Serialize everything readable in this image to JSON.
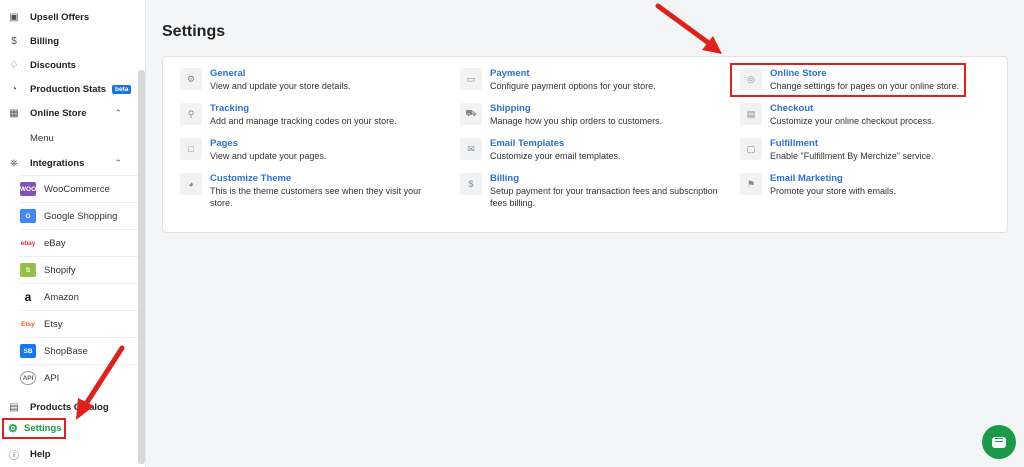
{
  "sidebar": {
    "items": [
      {
        "label": "Upsell Offers",
        "icon": "page-icon"
      },
      {
        "label": "Billing",
        "icon": "dollar-icon"
      },
      {
        "label": "Discounts",
        "icon": "tag-icon"
      },
      {
        "label": "Production Stats",
        "icon": "pie-chart-icon",
        "badge": "beta"
      },
      {
        "label": "Online Store",
        "icon": "store-icon"
      },
      {
        "label": "Integrations",
        "icon": "plug-icon"
      }
    ],
    "online_store_sub": "Menu",
    "integrations": [
      {
        "label": "WooCommerce",
        "logo": "WOO",
        "color": "#7f54b3"
      },
      {
        "label": "Google Shopping",
        "logo": "G",
        "color": "#4285f4"
      },
      {
        "label": "eBay",
        "logo": "ebay",
        "color": "#e53238"
      },
      {
        "label": "Shopify",
        "logo": "S",
        "color": "#95bf47"
      },
      {
        "label": "Amazon",
        "logo": "a",
        "color": "#111111"
      },
      {
        "label": "Etsy",
        "logo": "Etsy",
        "color": "#f16521"
      },
      {
        "label": "ShopBase",
        "logo": "SB",
        "color": "#1877f2"
      },
      {
        "label": "API",
        "logo": "API",
        "color": "#666666"
      }
    ],
    "products_catalog": "Products Catalog",
    "settings": "Settings",
    "help": "Help"
  },
  "main": {
    "title": "Settings",
    "settings": [
      {
        "title": "General",
        "desc": "View and update your store details.",
        "icon": "gear-icon"
      },
      {
        "title": "Payment",
        "desc": "Configure payment options for your store.",
        "icon": "credit-card-icon"
      },
      {
        "title": "Online Store",
        "desc": "Change settings for pages on your online store.",
        "icon": "globe-icon"
      },
      {
        "title": "Tracking",
        "desc": "Add and manage tracking codes on your store.",
        "icon": "search-icon"
      },
      {
        "title": "Shipping",
        "desc": "Manage how you ship orders to customers.",
        "icon": "truck-icon"
      },
      {
        "title": "Checkout",
        "desc": "Customize your online checkout process.",
        "icon": "cart-icon"
      },
      {
        "title": "Pages",
        "desc": "View and update your pages.",
        "icon": "file-icon"
      },
      {
        "title": "Email Templates",
        "desc": "Customize your email templates.",
        "icon": "mail-icon"
      },
      {
        "title": "Fulfillment",
        "desc": "Enable \"Fulfillment By Merchize\" service.",
        "icon": "box-icon"
      },
      {
        "title": "Customize Theme",
        "desc": "This is the theme customers see when they visit your store.",
        "icon": "palette-icon"
      },
      {
        "title": "Billing",
        "desc": "Setup payment for your transaction fees and subscription fees billing.",
        "icon": "dollar-icon"
      },
      {
        "title": "Email Marketing",
        "desc": "Promote your store with emails.",
        "icon": "megaphone-icon"
      }
    ]
  },
  "colors": {
    "accent": "#2e6fd1",
    "active": "#1a9a4a",
    "annotation": "#e0201c"
  }
}
